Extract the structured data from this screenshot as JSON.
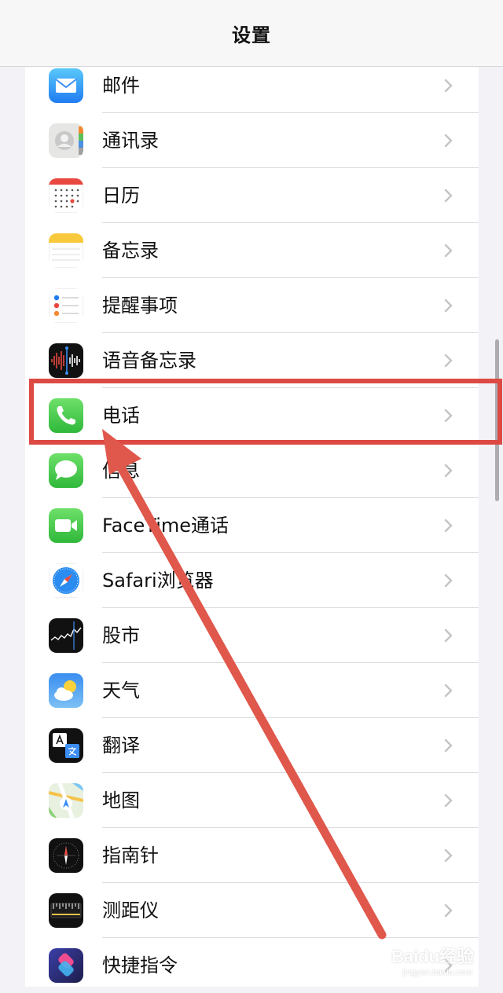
{
  "header": {
    "title": "设置"
  },
  "settings_items": [
    {
      "label": "邮件",
      "icon": "mail-icon"
    },
    {
      "label": "通讯录",
      "icon": "contacts-icon"
    },
    {
      "label": "日历",
      "icon": "calendar-icon"
    },
    {
      "label": "备忘录",
      "icon": "notes-icon"
    },
    {
      "label": "提醒事项",
      "icon": "reminders-icon"
    },
    {
      "label": "语音备忘录",
      "icon": "voice-memos-icon"
    },
    {
      "label": "电话",
      "icon": "phone-icon"
    },
    {
      "label": "信息",
      "icon": "messages-icon"
    },
    {
      "label": "FaceTime通话",
      "icon": "facetime-icon"
    },
    {
      "label": "Safari浏览器",
      "icon": "safari-icon"
    },
    {
      "label": "股市",
      "icon": "stocks-icon"
    },
    {
      "label": "天气",
      "icon": "weather-icon"
    },
    {
      "label": "翻译",
      "icon": "translate-icon"
    },
    {
      "label": "地图",
      "icon": "maps-icon"
    },
    {
      "label": "指南针",
      "icon": "compass-icon"
    },
    {
      "label": "测距仪",
      "icon": "measure-icon"
    },
    {
      "label": "快捷指令",
      "icon": "shortcuts-icon"
    }
  ],
  "annotation": {
    "highlighted_item": "电话",
    "color": "#dc4a43"
  },
  "watermark": {
    "main": "Baidu经验",
    "sub": "jingyan.baidu.com"
  }
}
